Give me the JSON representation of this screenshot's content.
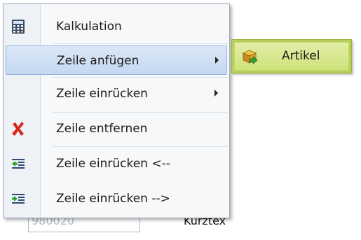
{
  "background": {
    "input_value": "980020",
    "label_fragment": "Kurztex"
  },
  "context_menu": {
    "items": [
      {
        "label": "Kalkulation",
        "icon": "calculator-icon"
      },
      {
        "label": "Zeile anfügen",
        "icon": "none",
        "has_submenu": true,
        "highlighted": true
      },
      {
        "label": "Zeile einrücken",
        "icon": "none",
        "has_submenu": true
      },
      {
        "label": "Zeile entfernen",
        "icon": "red-x-delete-icon"
      },
      {
        "label": "Zeile einrücken <--",
        "icon": "outdent-icon"
      },
      {
        "label": "Zeile einrücken -->",
        "icon": "indent-icon"
      }
    ]
  },
  "submenu": {
    "items": [
      {
        "label": "Artikel",
        "icon": "article-box-icon",
        "highlighted": true
      }
    ]
  },
  "colors": {
    "menu_highlight": "#c4d8f1",
    "submenu_background": "#b6cf5a",
    "submenu_highlight": "#d5e585",
    "delete_icon": "#d9261c",
    "indent_arrow": "#2c9e2c"
  }
}
